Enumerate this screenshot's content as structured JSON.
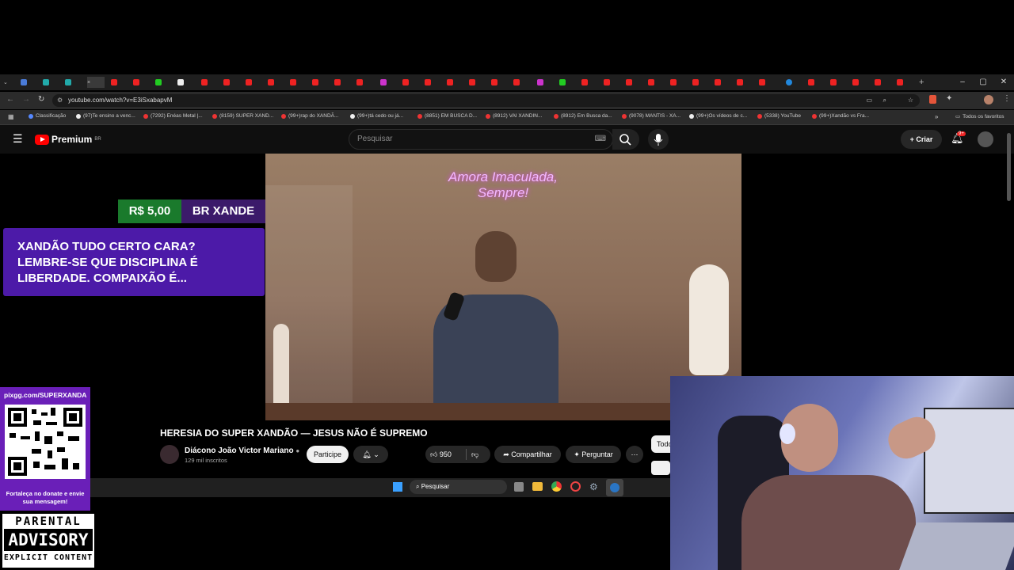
{
  "browser": {
    "url": "youtube.com/watch?v=E3iSxabapvM",
    "bookmarks": [
      {
        "label": "Classificação"
      },
      {
        "label": "(97)Te ensino a venc..."
      },
      {
        "label": "(7292) Enéas Metal |..."
      },
      {
        "label": "(8159) SUPER XAND..."
      },
      {
        "label": "(99+)rap do XANDÃ..."
      },
      {
        "label": "(99+)tá cedo ou já..."
      },
      {
        "label": "(8851) EM BUSCA D..."
      },
      {
        "label": "(8912) VAI XANDIN..."
      },
      {
        "label": "(8912) Em Busca da..."
      },
      {
        "label": "(9078) MANTIS - XA..."
      },
      {
        "label": "(99+)Os vídeos de c..."
      },
      {
        "label": "(5338) YouTube"
      },
      {
        "label": "(99+)Xandão vs Fra..."
      }
    ],
    "all_bookmarks": "Todos os favoritos"
  },
  "youtube": {
    "logo_text": "Premium",
    "logo_badge": "BR",
    "search_placeholder": "Pesquisar",
    "create_label": "Criar",
    "notif_count": "9+"
  },
  "video": {
    "neon_sign": "Amora Imaculada, Sempre!",
    "title": "HERESIA DO SUPER XANDÃO — JESUS NÃO É SUPREMO",
    "channel": "Diácono João Victor Mariano",
    "subscribers": "129 mil inscritos",
    "join_label": "Participe",
    "likes": "950",
    "share_label": "Compartilhar",
    "ask_label": "Perguntar",
    "chip_partial": "Todo"
  },
  "overlay": {
    "donate_amount": "R$ 5,00",
    "donor_name": "BR XANDE",
    "donate_message": "XANDÃO TUDO CERTO CARA? LEMBRE-SE QUE DISCIPLINA É LIBERDADE. COMPAIXÃO É...",
    "pix_url": "pixgg.com/SUPERXANDA",
    "qr_caption": "Fortaleça no donate e envie sua mensagem!",
    "advisory_line1": "PARENTAL",
    "advisory_line2": "ADVISORY",
    "advisory_line3": "EXPLICIT CONTENT"
  },
  "taskbar": {
    "search_placeholder": "Pesquisar"
  }
}
